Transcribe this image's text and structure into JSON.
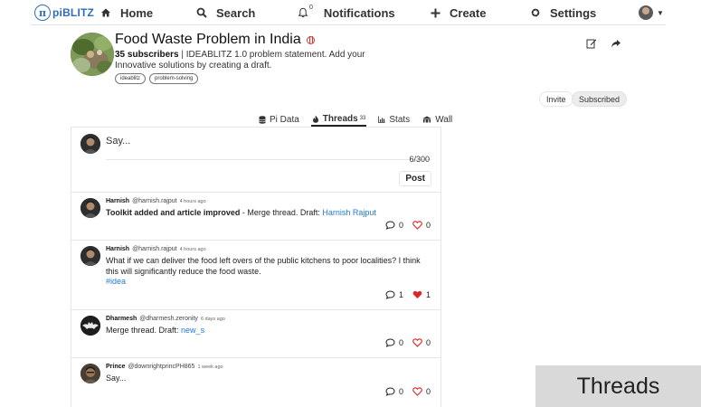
{
  "nav": {
    "logo_text": "piBLITZ",
    "logo_symbol": "π",
    "items": [
      {
        "label": "Home",
        "icon": "home-icon"
      },
      {
        "label": "Search",
        "icon": "search-icon"
      },
      {
        "label": "Notifications",
        "icon": "bell-icon",
        "badge": "0"
      },
      {
        "label": "Create",
        "icon": "plus-icon"
      },
      {
        "label": "Settings",
        "icon": "gear-icon"
      }
    ]
  },
  "header": {
    "title": "Food Waste Problem in India",
    "subscribers": "35 subscribers",
    "description": " | IDEABLITZ 1.0 problem statement. Add your Innovative solutions by creating a draft.",
    "tags": [
      "ideablitz",
      "problem-solving"
    ],
    "invite_label": "Invite",
    "subscribed_label": "Subscribed"
  },
  "tabs": [
    {
      "label": "Pi Data",
      "icon": "database-icon"
    },
    {
      "label": "Threads",
      "icon": "fire-icon",
      "count": "33",
      "active": true
    },
    {
      "label": "Stats",
      "icon": "bar-chart-icon"
    },
    {
      "label": "Wall",
      "icon": "building-icon"
    }
  ],
  "composer": {
    "placeholder": "Say...",
    "counter": "6/300",
    "post_label": "Post"
  },
  "threads": [
    {
      "name": "Harnish",
      "handle": "@harnish.rajput",
      "time": "4 hours ago",
      "bold_text": "Toolkit added and article improved",
      "text": " - Merge thread. Draft: ",
      "link": "Harnish Rajput",
      "comments": "0",
      "likes": "0",
      "liked": false
    },
    {
      "name": "Harnish",
      "handle": "@harnish.rajput",
      "time": "4 hours ago",
      "text": "What if we can deliver the food left overs of the public kitchens to poor localities? I think this will significantly reduce the food waste.",
      "link": "#idea",
      "comments": "1",
      "likes": "1",
      "liked": true
    },
    {
      "name": "Dharmesh",
      "handle": "@dharmesh.zeronity",
      "time": "6 days ago",
      "text": "Merge thread. Draft: ",
      "link": "new_s",
      "comments": "0",
      "likes": "0",
      "liked": false
    },
    {
      "name": "Prince",
      "handle": "@downrightprincPH865",
      "time": "1 week ago",
      "text": "Say...",
      "comments": "0",
      "likes": "0",
      "liked": false
    }
  ],
  "overlay_label": "Threads",
  "colors": {
    "accent": "#2f6fb5",
    "link": "#1f7ad6",
    "heart": "#e02424"
  }
}
